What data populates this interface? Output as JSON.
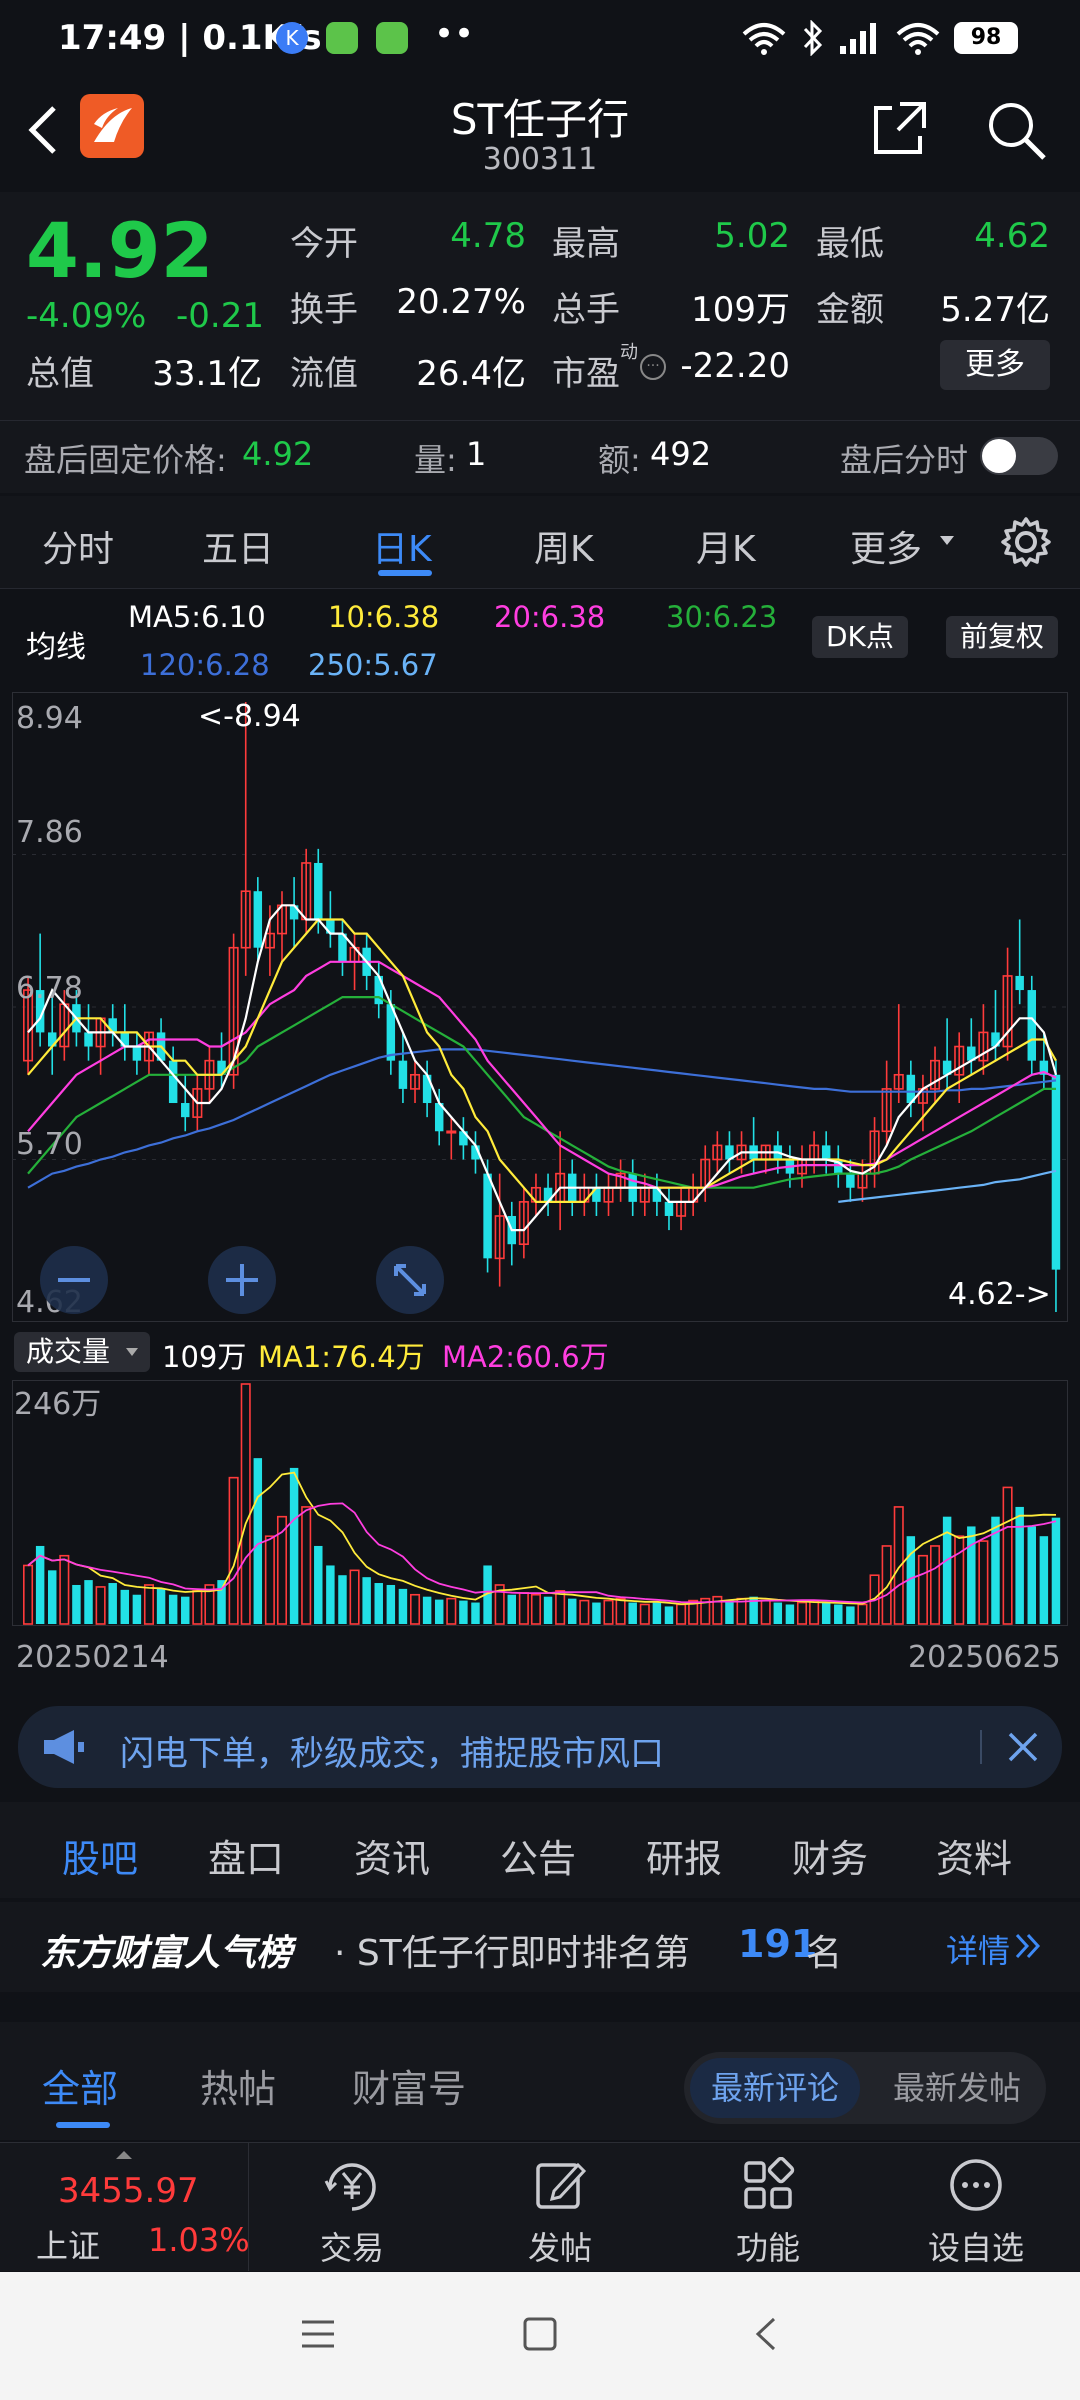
{
  "status_bar": {
    "time_speed": "17:49 | 0.1K/s",
    "battery": "98",
    "more": "••"
  },
  "header": {
    "title": "ST任子行",
    "code": "300311"
  },
  "quote": {
    "price": "4.92",
    "change_pct": "-4.09%",
    "change": "-0.21",
    "fields": [
      {
        "label": "今开",
        "value": "4.78"
      },
      {
        "label": "最高",
        "value": "5.02"
      },
      {
        "label": "最低",
        "value": "4.62"
      },
      {
        "label": "换手",
        "value": "20.27%"
      },
      {
        "label": "总手",
        "value": "109万"
      },
      {
        "label": "金额",
        "value": "5.27亿"
      },
      {
        "label": "总值",
        "value": "33.1亿"
      },
      {
        "label": "流值",
        "value": "26.4亿"
      },
      {
        "label": "市盈",
        "value": "-22.20"
      }
    ],
    "pe_sup": "动",
    "more_label": "更多"
  },
  "after_hours": {
    "price_label": "盘后固定价格:",
    "price": "4.92",
    "vol_label": "量:",
    "vol": "1",
    "amt_label": "额:",
    "amt": "492",
    "timeshare_label": "盘后分时"
  },
  "chart_tabs": [
    "分时",
    "五日",
    "日K",
    "周K",
    "月K",
    "更多"
  ],
  "active_chart_tab": "日K",
  "ma_header": {
    "label": "均线",
    "ma5": "MA5:6.10",
    "ma10": "10:6.38",
    "ma20": "20:6.38",
    "ma30": "30:6.23",
    "ma120": "120:6.28",
    "ma250": "250:5.67",
    "dk_label": "DK点",
    "adjust_label": "前复权"
  },
  "colors": {
    "up": "#ff3b3b",
    "down": "#22e0e6",
    "ma5": "#ffffff",
    "ma10": "#ffeb3b",
    "ma20": "#ff3ee0",
    "ma30": "#25b03a",
    "ma120": "#3d6fd8",
    "ma250": "#6ab3f7",
    "accent": "#3d8af7"
  },
  "chart_data": {
    "type": "candlestick",
    "ylim": [
      4.62,
      8.94
    ],
    "y_ticks": [
      "8.94",
      "7.86",
      "6.78",
      "5.70",
      "4.62"
    ],
    "high_marker": "<-8.94",
    "low_marker": "4.62->",
    "volume_label": "成交量",
    "volume_value": "109万",
    "vol_ma1": "MA1:76.4万",
    "vol_ma2": "MA2:60.6万",
    "volume_max": "246万",
    "x_start": "20250214",
    "x_end": "20250625",
    "ohlc": [
      [
        6.4,
        7.0,
        6.3,
        6.9
      ],
      [
        6.9,
        7.3,
        6.5,
        6.6
      ],
      [
        6.6,
        6.9,
        6.3,
        6.5
      ],
      [
        6.5,
        6.9,
        6.4,
        6.8
      ],
      [
        6.8,
        6.9,
        6.5,
        6.6
      ],
      [
        6.6,
        6.8,
        6.4,
        6.5
      ],
      [
        6.5,
        6.7,
        6.3,
        6.7
      ],
      [
        6.7,
        6.8,
        6.5,
        6.6
      ],
      [
        6.6,
        6.8,
        6.4,
        6.5
      ],
      [
        6.5,
        6.6,
        6.3,
        6.4
      ],
      [
        6.4,
        6.6,
        6.3,
        6.6
      ],
      [
        6.6,
        6.7,
        6.4,
        6.4
      ],
      [
        6.4,
        6.5,
        6.1,
        6.1
      ],
      [
        6.1,
        6.3,
        5.9,
        6.0
      ],
      [
        6.0,
        6.3,
        5.9,
        6.2
      ],
      [
        6.2,
        6.5,
        6.1,
        6.4
      ],
      [
        6.4,
        6.6,
        6.2,
        6.3
      ],
      [
        6.3,
        7.3,
        6.2,
        7.2
      ],
      [
        7.2,
        8.94,
        7.0,
        7.6
      ],
      [
        7.6,
        7.7,
        7.1,
        7.2
      ],
      [
        7.2,
        7.5,
        7.0,
        7.3
      ],
      [
        7.3,
        7.6,
        7.1,
        7.5
      ],
      [
        7.5,
        7.7,
        7.2,
        7.4
      ],
      [
        7.4,
        7.9,
        7.3,
        7.8
      ],
      [
        7.8,
        7.9,
        7.3,
        7.4
      ],
      [
        7.4,
        7.6,
        7.2,
        7.3
      ],
      [
        7.3,
        7.4,
        7.0,
        7.1
      ],
      [
        7.1,
        7.3,
        6.9,
        7.2
      ],
      [
        7.2,
        7.3,
        6.9,
        7.0
      ],
      [
        7.0,
        7.1,
        6.7,
        6.8
      ],
      [
        6.8,
        6.9,
        6.3,
        6.4
      ],
      [
        6.4,
        6.6,
        6.1,
        6.2
      ],
      [
        6.2,
        6.4,
        6.1,
        6.3
      ],
      [
        6.3,
        6.4,
        6.0,
        6.1
      ],
      [
        6.1,
        6.2,
        5.8,
        5.9
      ],
      [
        5.9,
        6.0,
        5.7,
        5.9
      ],
      [
        5.9,
        6.0,
        5.7,
        5.8
      ],
      [
        5.8,
        5.9,
        5.6,
        5.7
      ],
      [
        5.6,
        5.7,
        4.9,
        5.0
      ],
      [
        5.0,
        5.6,
        4.8,
        5.3
      ],
      [
        5.3,
        5.4,
        4.95,
        5.1
      ],
      [
        5.1,
        5.5,
        5.0,
        5.4
      ],
      [
        5.4,
        5.6,
        5.3,
        5.5
      ],
      [
        5.5,
        5.6,
        5.3,
        5.4
      ],
      [
        5.4,
        5.9,
        5.2,
        5.6
      ],
      [
        5.6,
        5.7,
        5.3,
        5.4
      ],
      [
        5.4,
        5.6,
        5.3,
        5.5
      ],
      [
        5.5,
        5.6,
        5.3,
        5.4
      ],
      [
        5.4,
        5.6,
        5.3,
        5.5
      ],
      [
        5.5,
        5.7,
        5.4,
        5.6
      ],
      [
        5.6,
        5.7,
        5.3,
        5.4
      ],
      [
        5.4,
        5.6,
        5.3,
        5.5
      ],
      [
        5.5,
        5.6,
        5.3,
        5.4
      ],
      [
        5.4,
        5.5,
        5.2,
        5.3
      ],
      [
        5.3,
        5.5,
        5.2,
        5.4
      ],
      [
        5.4,
        5.6,
        5.3,
        5.5
      ],
      [
        5.5,
        5.8,
        5.4,
        5.7
      ],
      [
        5.7,
        5.9,
        5.6,
        5.8
      ],
      [
        5.8,
        5.9,
        5.6,
        5.7
      ],
      [
        5.7,
        5.9,
        5.6,
        5.8
      ],
      [
        5.8,
        6.0,
        5.6,
        5.7
      ],
      [
        5.7,
        5.8,
        5.6,
        5.8
      ],
      [
        5.8,
        5.9,
        5.6,
        5.7
      ],
      [
        5.7,
        5.8,
        5.5,
        5.6
      ],
      [
        5.6,
        5.8,
        5.5,
        5.7
      ],
      [
        5.7,
        5.9,
        5.6,
        5.8
      ],
      [
        5.8,
        5.9,
        5.6,
        5.7
      ],
      [
        5.7,
        5.8,
        5.5,
        5.6
      ],
      [
        5.6,
        5.7,
        5.4,
        5.5
      ],
      [
        5.5,
        5.7,
        5.4,
        5.6
      ],
      [
        5.6,
        6.0,
        5.5,
        5.9
      ],
      [
        5.9,
        6.4,
        5.8,
        6.2
      ],
      [
        6.2,
        6.8,
        6.1,
        6.3
      ],
      [
        6.3,
        6.4,
        6.0,
        6.1
      ],
      [
        6.1,
        6.3,
        5.9,
        6.2
      ],
      [
        6.2,
        6.5,
        6.1,
        6.4
      ],
      [
        6.4,
        6.7,
        6.2,
        6.3
      ],
      [
        6.3,
        6.6,
        6.1,
        6.5
      ],
      [
        6.5,
        6.7,
        6.3,
        6.4
      ],
      [
        6.4,
        6.8,
        6.3,
        6.6
      ],
      [
        6.6,
        6.9,
        6.4,
        6.5
      ],
      [
        6.5,
        7.2,
        6.4,
        7.0
      ],
      [
        7.0,
        7.4,
        6.8,
        6.9
      ],
      [
        6.9,
        7.0,
        6.3,
        6.4
      ],
      [
        6.4,
        6.6,
        6.2,
        6.3
      ],
      [
        6.3,
        6.4,
        4.62,
        4.92
      ]
    ],
    "volume": [
      60,
      80,
      55,
      70,
      40,
      45,
      38,
      42,
      35,
      30,
      40,
      36,
      30,
      28,
      34,
      40,
      45,
      150,
      246,
      170,
      90,
      110,
      160,
      120,
      80,
      60,
      50,
      55,
      48,
      42,
      40,
      36,
      30,
      28,
      25,
      26,
      24,
      22,
      60,
      40,
      30,
      32,
      30,
      28,
      34,
      26,
      24,
      22,
      24,
      26,
      22,
      20,
      22,
      18,
      20,
      24,
      26,
      28,
      24,
      26,
      28,
      24,
      22,
      20,
      22,
      24,
      22,
      20,
      18,
      20,
      50,
      80,
      120,
      90,
      70,
      80,
      110,
      90,
      100,
      85,
      110,
      140,
      120,
      100,
      90,
      109
    ],
    "ma5": [
      6.6,
      6.7,
      6.9,
      6.8,
      6.7,
      6.6,
      6.6,
      6.6,
      6.5,
      6.5,
      6.5,
      6.4,
      6.3,
      6.2,
      6.1,
      6.1,
      6.2,
      6.4,
      6.7,
      7.1,
      7.4,
      7.5,
      7.5,
      7.4,
      7.4,
      7.3,
      7.3,
      7.2,
      7.1,
      7.0,
      6.8,
      6.6,
      6.4,
      6.3,
      6.1,
      6.0,
      5.9,
      5.8,
      5.6,
      5.4,
      5.2,
      5.2,
      5.3,
      5.4,
      5.5,
      5.5,
      5.5,
      5.5,
      5.5,
      5.5,
      5.5,
      5.5,
      5.5,
      5.4,
      5.4,
      5.4,
      5.5,
      5.6,
      5.7,
      5.75,
      5.75,
      5.75,
      5.75,
      5.72,
      5.7,
      5.7,
      5.7,
      5.68,
      5.62,
      5.6,
      5.65,
      5.8,
      6.0,
      6.1,
      6.2,
      6.25,
      6.3,
      6.35,
      6.4,
      6.45,
      6.5,
      6.6,
      6.7,
      6.7,
      6.6,
      6.3
    ],
    "ma10": [
      6.3,
      6.4,
      6.5,
      6.6,
      6.7,
      6.7,
      6.7,
      6.6,
      6.6,
      6.6,
      6.5,
      6.5,
      6.4,
      6.4,
      6.3,
      6.3,
      6.3,
      6.4,
      6.5,
      6.7,
      6.9,
      7.1,
      7.2,
      7.3,
      7.4,
      7.4,
      7.4,
      7.3,
      7.3,
      7.2,
      7.1,
      7.0,
      6.8,
      6.6,
      6.5,
      6.3,
      6.2,
      6.0,
      5.9,
      5.7,
      5.6,
      5.5,
      5.4,
      5.4,
      5.4,
      5.4,
      5.4,
      5.5,
      5.5,
      5.5,
      5.5,
      5.5,
      5.5,
      5.5,
      5.5,
      5.5,
      5.5,
      5.55,
      5.6,
      5.65,
      5.7,
      5.7,
      5.7,
      5.7,
      5.7,
      5.7,
      5.7,
      5.7,
      5.68,
      5.66,
      5.66,
      5.7,
      5.8,
      5.9,
      6.0,
      6.1,
      6.2,
      6.25,
      6.3,
      6.35,
      6.4,
      6.45,
      6.5,
      6.55,
      6.55,
      6.4
    ],
    "ma20": [
      5.9,
      6.0,
      6.1,
      6.2,
      6.3,
      6.35,
      6.4,
      6.45,
      6.5,
      6.5,
      6.55,
      6.55,
      6.55,
      6.55,
      6.55,
      6.5,
      6.5,
      6.55,
      6.6,
      6.7,
      6.8,
      6.85,
      6.9,
      7.0,
      7.05,
      7.1,
      7.1,
      7.1,
      7.1,
      7.1,
      7.05,
      7.0,
      6.95,
      6.9,
      6.85,
      6.75,
      6.65,
      6.55,
      6.4,
      6.3,
      6.2,
      6.1,
      6.0,
      5.9,
      5.8,
      5.75,
      5.7,
      5.65,
      5.6,
      5.58,
      5.55,
      5.53,
      5.5,
      5.5,
      5.5,
      5.5,
      5.5,
      5.52,
      5.55,
      5.58,
      5.6,
      5.62,
      5.64,
      5.65,
      5.66,
      5.66,
      5.66,
      5.66,
      5.66,
      5.66,
      5.67,
      5.7,
      5.75,
      5.8,
      5.85,
      5.9,
      5.95,
      6.0,
      6.05,
      6.1,
      6.15,
      6.2,
      6.25,
      6.3,
      6.32,
      6.28
    ],
    "ma30": [
      5.6,
      5.7,
      5.8,
      5.9,
      6.0,
      6.05,
      6.1,
      6.15,
      6.2,
      6.25,
      6.3,
      6.3,
      6.3,
      6.3,
      6.3,
      6.3,
      6.3,
      6.35,
      6.4,
      6.5,
      6.55,
      6.6,
      6.65,
      6.7,
      6.75,
      6.8,
      6.85,
      6.85,
      6.85,
      6.85,
      6.8,
      6.75,
      6.7,
      6.65,
      6.6,
      6.55,
      6.5,
      6.4,
      6.3,
      6.2,
      6.1,
      6.0,
      5.95,
      5.9,
      5.85,
      5.8,
      5.75,
      5.7,
      5.65,
      5.62,
      5.6,
      5.58,
      5.56,
      5.54,
      5.52,
      5.5,
      5.5,
      5.5,
      5.5,
      5.5,
      5.5,
      5.52,
      5.54,
      5.56,
      5.57,
      5.58,
      5.59,
      5.6,
      5.6,
      5.6,
      5.6,
      5.62,
      5.65,
      5.7,
      5.74,
      5.78,
      5.82,
      5.86,
      5.9,
      5.95,
      6.0,
      6.05,
      6.1,
      6.15,
      6.2,
      6.2
    ],
    "ma120": [
      5.5,
      5.55,
      5.6,
      5.62,
      5.65,
      5.67,
      5.7,
      5.72,
      5.75,
      5.77,
      5.8,
      5.82,
      5.85,
      5.87,
      5.9,
      5.92,
      5.95,
      5.98,
      6.02,
      6.06,
      6.1,
      6.14,
      6.18,
      6.22,
      6.26,
      6.3,
      6.33,
      6.36,
      6.39,
      6.42,
      6.44,
      6.45,
      6.46,
      6.47,
      6.48,
      6.48,
      6.48,
      6.48,
      6.47,
      6.46,
      6.45,
      6.44,
      6.43,
      6.42,
      6.41,
      6.4,
      6.39,
      6.38,
      6.37,
      6.36,
      6.35,
      6.34,
      6.33,
      6.32,
      6.31,
      6.3,
      6.29,
      6.28,
      6.27,
      6.26,
      6.25,
      6.24,
      6.23,
      6.22,
      6.21,
      6.2,
      6.2,
      6.19,
      6.18,
      6.18,
      6.18,
      6.18,
      6.18,
      6.18,
      6.18,
      6.18,
      6.19,
      6.19,
      6.2,
      6.2,
      6.21,
      6.22,
      6.23,
      6.24,
      6.25,
      6.26
    ],
    "ma250_start_index": 67,
    "ma250": [
      5.4,
      5.41,
      5.42,
      5.43,
      5.44,
      5.45,
      5.46,
      5.47,
      5.48,
      5.49,
      5.5,
      5.51,
      5.52,
      5.54,
      5.55,
      5.56,
      5.58,
      5.6,
      5.62
    ]
  },
  "banner": {
    "text": "闪电下单，秒级成交，捕捉股市风口"
  },
  "bottom_tabs": [
    "股吧",
    "盘口",
    "资讯",
    "公告",
    "研报",
    "财务",
    "资料"
  ],
  "rank": {
    "brand": "东方财富人气榜",
    "prefix": "· ST任子行即时排名第",
    "rank_no": "191",
    "suffix": "名",
    "detail": "详情"
  },
  "forum_tabs": [
    "全部",
    "热帖",
    "财富号"
  ],
  "forum_sort": [
    "最新评论",
    "最新发帖"
  ],
  "index": {
    "value": "3455.97",
    "name": "上证",
    "change": "1.03%"
  },
  "nav": [
    "交易",
    "发帖",
    "功能",
    "设自选"
  ]
}
